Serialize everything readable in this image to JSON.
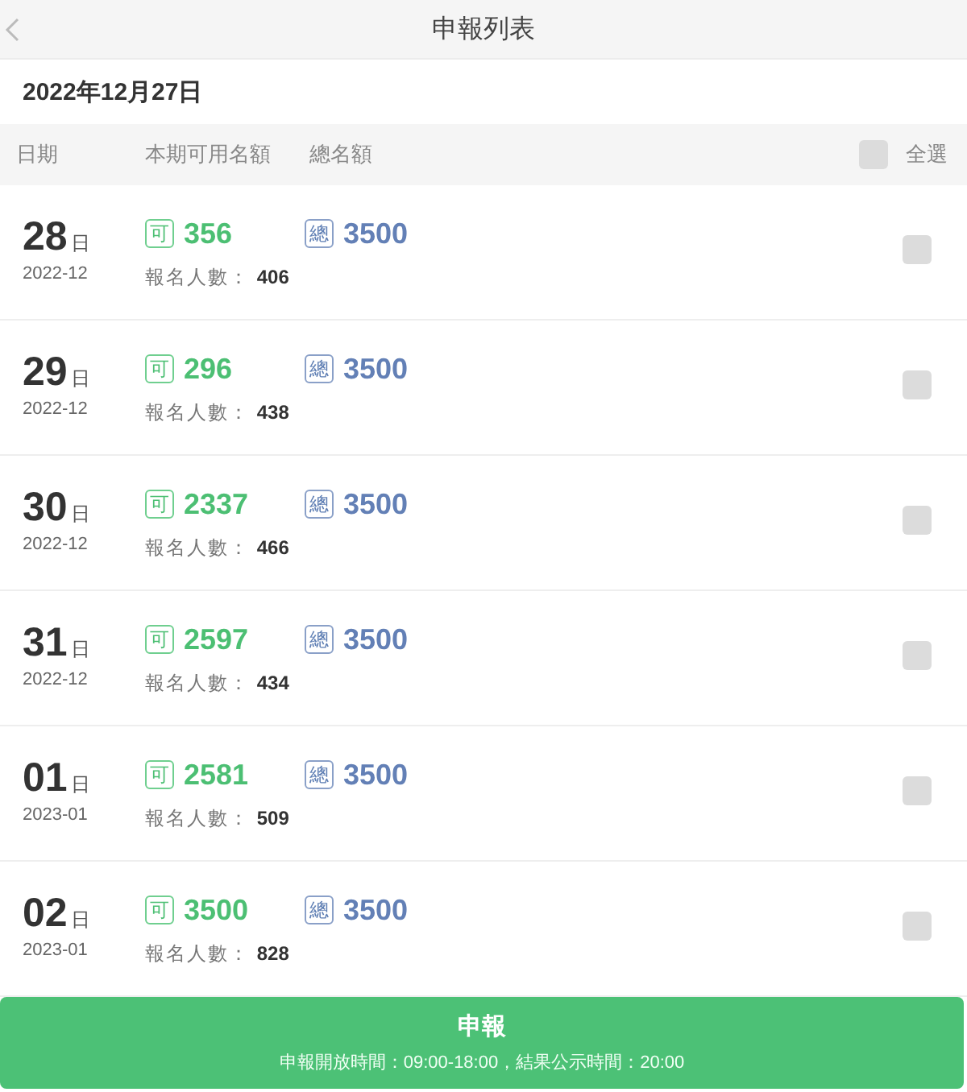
{
  "nav": {
    "title": "申報列表"
  },
  "date_heading": "2022年12月27日",
  "header": {
    "columns": [
      "日期",
      "本期可用名額",
      "總名額"
    ],
    "select_all": {
      "label": "全選",
      "checked": false
    }
  },
  "rows": [
    {
      "day": "28",
      "day_unit": "日",
      "month": "2022-12",
      "available_badge": "可",
      "available": "356",
      "total_badge": "總",
      "total": "3500",
      "applicants": "報名人數： **406**",
      "checked": false
    },
    {
      "day": "29",
      "day_unit": "日",
      "month": "2022-12",
      "available_badge": "可",
      "available": "296",
      "total_badge": "總",
      "total": "3500",
      "applicants": "報名人數： **438**",
      "checked": false
    },
    {
      "day": "30",
      "day_unit": "日",
      "month": "2022-12",
      "available_badge": "可",
      "available": "2337",
      "total_badge": "總",
      "total": "3500",
      "applicants": "報名人數： **466**",
      "checked": false
    },
    {
      "day": "31",
      "day_unit": "日",
      "month": "2022-12",
      "available_badge": "可",
      "available": "2597",
      "total_badge": "總",
      "total": "3500",
      "applicants": "報名人數： **434**",
      "checked": false
    },
    {
      "day": "01",
      "day_unit": "日",
      "month": "2023-01",
      "available_badge": "可",
      "available": "2581",
      "total_badge": "總",
      "total": "3500",
      "applicants": "報名人數： **509**",
      "checked": false
    },
    {
      "day": "02",
      "day_unit": "日",
      "month": "2023-01",
      "available_badge": "可",
      "available": "3500",
      "total_badge": "總",
      "total": "3500",
      "applicants": "報名人數： **828**",
      "checked": false
    }
  ],
  "submit": {
    "label": "申報",
    "note": "申報開放時間：09:00-18:00，結果公示時間：20:00"
  }
}
